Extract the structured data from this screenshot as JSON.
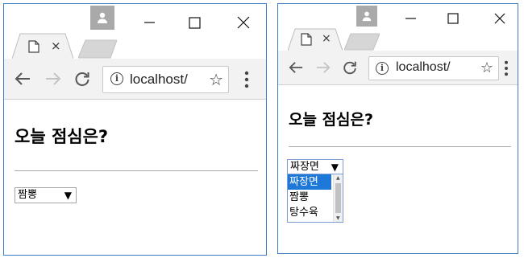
{
  "windows": [
    {
      "id": "w1",
      "address": "localhost/",
      "page_title": "오늘 점심은?",
      "select_value": "짬뽕",
      "dropdown_open": false
    },
    {
      "id": "w2",
      "address": "localhost/",
      "page_title": "오늘 점심은?",
      "select_value": "짜장면",
      "dropdown_open": true,
      "options": [
        "짜장면",
        "짬뽕",
        "탕수육"
      ],
      "highlighted_option": "짜장면"
    }
  ],
  "tab": {
    "close_glyph": "×"
  },
  "icons": {
    "avatar": "person-icon",
    "back": "back-arrow-icon",
    "forward": "forward-arrow-icon",
    "reload": "reload-icon",
    "info": "info-icon",
    "star": "star-icon",
    "menu": "menu-dots-icon",
    "minimize": "minimize-icon",
    "maximize": "maximize-icon",
    "close": "close-icon"
  },
  "glyphs": {
    "info": "i",
    "star": "☆",
    "select_arrow": "▼"
  },
  "colors": {
    "highlight": "#1e78d7",
    "window_border": "#3b7dc4"
  }
}
